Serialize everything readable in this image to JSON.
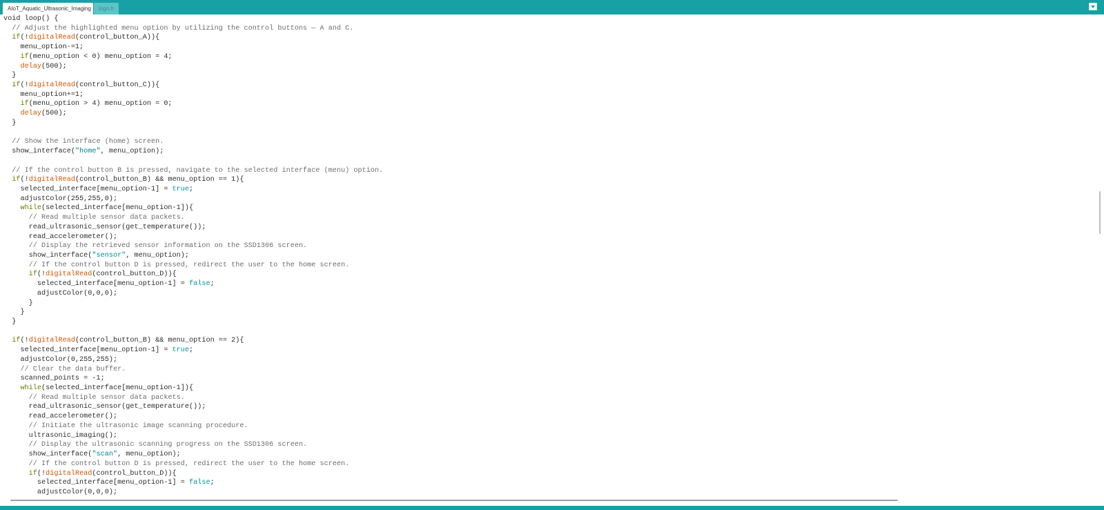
{
  "tabs": [
    {
      "label": "AIoT_Aquatic_Ultrasonic_Imaging",
      "active": true
    },
    {
      "label": "logo.h",
      "active": false
    }
  ],
  "tab_menu_icon": "chevron-down-icon",
  "colors": {
    "accent": "#17a1a5",
    "keyword": "#6a7c00",
    "function": "#d35400",
    "string": "#00838f",
    "literal": "#00979c",
    "comment": "#6e6e6e",
    "text": "#2c2c2c"
  },
  "code_lines": [
    [
      [
        "t",
        "void "
      ],
      [
        "t",
        "loop() {"
      ]
    ],
    [
      [
        "c",
        "  // Adjust the highlighted menu option by utilizing the control buttons — A and C."
      ]
    ],
    [
      [
        "k",
        "  if"
      ],
      [
        "t",
        "(!"
      ],
      [
        "f",
        "digitalRead"
      ],
      [
        "t",
        "(control_button_A)){"
      ]
    ],
    [
      [
        "t",
        "    menu_option-=1;"
      ]
    ],
    [
      [
        "k",
        "    if"
      ],
      [
        "t",
        "(menu_option < 0) menu_option = 4;"
      ]
    ],
    [
      [
        "f",
        "    delay"
      ],
      [
        "t",
        "(500);"
      ]
    ],
    [
      [
        "t",
        "  }"
      ]
    ],
    [
      [
        "k",
        "  if"
      ],
      [
        "t",
        "(!"
      ],
      [
        "f",
        "digitalRead"
      ],
      [
        "t",
        "(control_button_C)){"
      ]
    ],
    [
      [
        "t",
        "    menu_option+=1;"
      ]
    ],
    [
      [
        "k",
        "    if"
      ],
      [
        "t",
        "(menu_option > 4) menu_option = 0;"
      ]
    ],
    [
      [
        "f",
        "    delay"
      ],
      [
        "t",
        "(500);"
      ]
    ],
    [
      [
        "t",
        "  }"
      ]
    ],
    [
      [
        "t",
        ""
      ]
    ],
    [
      [
        "c",
        "  // Show the interface (home) screen."
      ]
    ],
    [
      [
        "t",
        "  show_interface("
      ],
      [
        "s",
        "\"home\""
      ],
      [
        "t",
        ", menu_option);"
      ]
    ],
    [
      [
        "t",
        ""
      ]
    ],
    [
      [
        "c",
        "  // If the control button B is pressed, navigate to the selected interface (menu) option."
      ]
    ],
    [
      [
        "k",
        "  if"
      ],
      [
        "t",
        "(!"
      ],
      [
        "f",
        "digitalRead"
      ],
      [
        "t",
        "(control_button_B) && menu_option == 1){"
      ]
    ],
    [
      [
        "t",
        "    selected_interface[menu_option-1] = "
      ],
      [
        "l",
        "true"
      ],
      [
        "t",
        ";"
      ]
    ],
    [
      [
        "t",
        "    adjustColor(255,255,0);"
      ]
    ],
    [
      [
        "k",
        "    while"
      ],
      [
        "t",
        "(selected_interface[menu_option-1]){"
      ]
    ],
    [
      [
        "c",
        "      // Read multiple sensor data packets."
      ]
    ],
    [
      [
        "t",
        "      read_ultrasonic_sensor(get_temperature());"
      ]
    ],
    [
      [
        "t",
        "      read_accelerometer();"
      ]
    ],
    [
      [
        "c",
        "      // Display the retrieved sensor information on the SSD1306 screen."
      ]
    ],
    [
      [
        "t",
        "      show_interface("
      ],
      [
        "s",
        "\"sensor\""
      ],
      [
        "t",
        ", menu_option);"
      ]
    ],
    [
      [
        "c",
        "      // If the control button D is pressed, redirect the user to the home screen."
      ]
    ],
    [
      [
        "k",
        "      if"
      ],
      [
        "t",
        "(!"
      ],
      [
        "f",
        "digitalRead"
      ],
      [
        "t",
        "(control_button_D)){"
      ]
    ],
    [
      [
        "t",
        "        selected_interface[menu_option-1] = "
      ],
      [
        "l",
        "false"
      ],
      [
        "t",
        ";"
      ]
    ],
    [
      [
        "t",
        "        adjustColor(0,0,0);"
      ]
    ],
    [
      [
        "t",
        "      }"
      ]
    ],
    [
      [
        "t",
        "    }"
      ]
    ],
    [
      [
        "t",
        "  }"
      ]
    ],
    [
      [
        "t",
        ""
      ]
    ],
    [
      [
        "k",
        "  if"
      ],
      [
        "t",
        "(!"
      ],
      [
        "f",
        "digitalRead"
      ],
      [
        "t",
        "(control_button_B) && menu_option == 2){"
      ]
    ],
    [
      [
        "t",
        "    selected_interface[menu_option-1] = "
      ],
      [
        "l",
        "true"
      ],
      [
        "t",
        ";"
      ]
    ],
    [
      [
        "t",
        "    adjustColor(0,255,255);"
      ]
    ],
    [
      [
        "c",
        "    // Clear the data buffer."
      ]
    ],
    [
      [
        "t",
        "    scanned_points = -1;"
      ]
    ],
    [
      [
        "k",
        "    while"
      ],
      [
        "t",
        "(selected_interface[menu_option-1]){"
      ]
    ],
    [
      [
        "c",
        "      // Read multiple sensor data packets."
      ]
    ],
    [
      [
        "t",
        "      read_ultrasonic_sensor(get_temperature());"
      ]
    ],
    [
      [
        "t",
        "      read_accelerometer();"
      ]
    ],
    [
      [
        "c",
        "      // Initiate the ultrasonic image scanning procedure."
      ]
    ],
    [
      [
        "t",
        "      ultrasonic_imaging();"
      ]
    ],
    [
      [
        "c",
        "      // Display the ultrasonic scanning progress on the SSD1306 screen."
      ]
    ],
    [
      [
        "t",
        "      show_interface("
      ],
      [
        "s",
        "\"scan\""
      ],
      [
        "t",
        ", menu_option);"
      ]
    ],
    [
      [
        "c",
        "      // If the control button D is pressed, redirect the user to the home screen."
      ]
    ],
    [
      [
        "k",
        "      if"
      ],
      [
        "t",
        "(!"
      ],
      [
        "f",
        "digitalRead"
      ],
      [
        "t",
        "(control_button_D)){"
      ]
    ],
    [
      [
        "t",
        "        selected_interface[menu_option-1] = "
      ],
      [
        "l",
        "false"
      ],
      [
        "t",
        ";"
      ]
    ],
    [
      [
        "t",
        "        adjustColor(0,0,0);"
      ]
    ]
  ]
}
